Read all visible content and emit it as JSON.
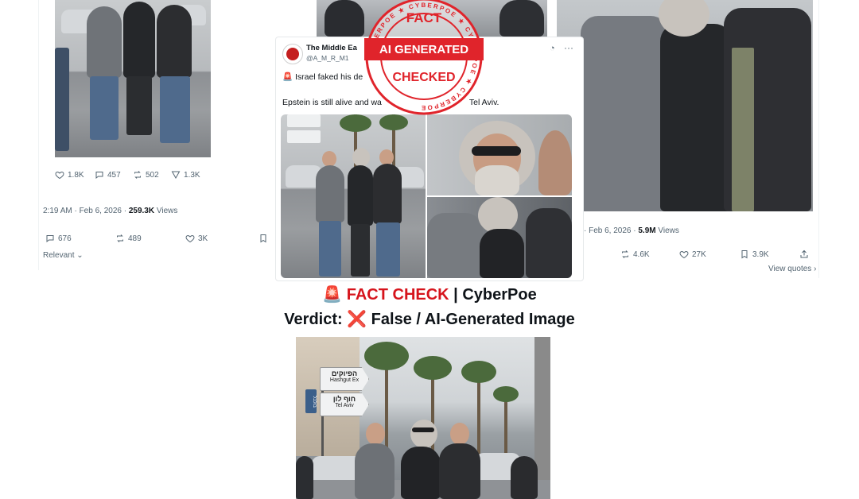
{
  "left_card": {
    "stats": {
      "likes": "1.8K",
      "replies": "457",
      "reposts": "502",
      "views": "1.3K"
    },
    "timestamp": "2:19 AM · Feb 6, 2026 · ",
    "views_count": "259.3K",
    "views_label": " Views",
    "actions": {
      "replies": "676",
      "reposts": "489",
      "likes": "3K"
    },
    "sort_label": "Relevant"
  },
  "center_card": {
    "account_name": "The Middle Ea",
    "account_handle": "@A_M_R_M1",
    "line1": "🚨 Israel faked his de",
    "line2": "Epstein is still alive and wa",
    "line2_tail": "Tel Aviv."
  },
  "right_card": {
    "timestamp": "· Feb 6, 2026 · ",
    "views_count": "5.9M",
    "views_label": " Views",
    "actions": {
      "reposts": "4.6K",
      "likes": "27K",
      "bookmarks": "3.9K"
    },
    "view_quotes": "View quotes"
  },
  "stamp": {
    "top": "FACT",
    "middle": "AI GENERATED",
    "bottom": "CHECKED",
    "ring_text": "CYBERPOE"
  },
  "headline": {
    "emoji": "🚨",
    "fact_check": "FACT CHECK",
    "separator": " | ",
    "brand": "CyberPoe",
    "verdict_label": "Verdict: ",
    "verdict_icon": "❌",
    "verdict_text": " False / AI-Generated Image"
  },
  "bottom_photo": {
    "sign_top_hebrew": "הפיוקים",
    "sign_top_latin": "Hashgut Ex",
    "sign_bottom_hebrew": "חוף לון",
    "sign_bottom_latin": "Tel Aviv",
    "side_sign": "בולבל"
  },
  "colors": {
    "accent_red": "#d6141c",
    "stamp_red": "#e0242b",
    "text": "#0f1419",
    "muted": "#536471"
  }
}
